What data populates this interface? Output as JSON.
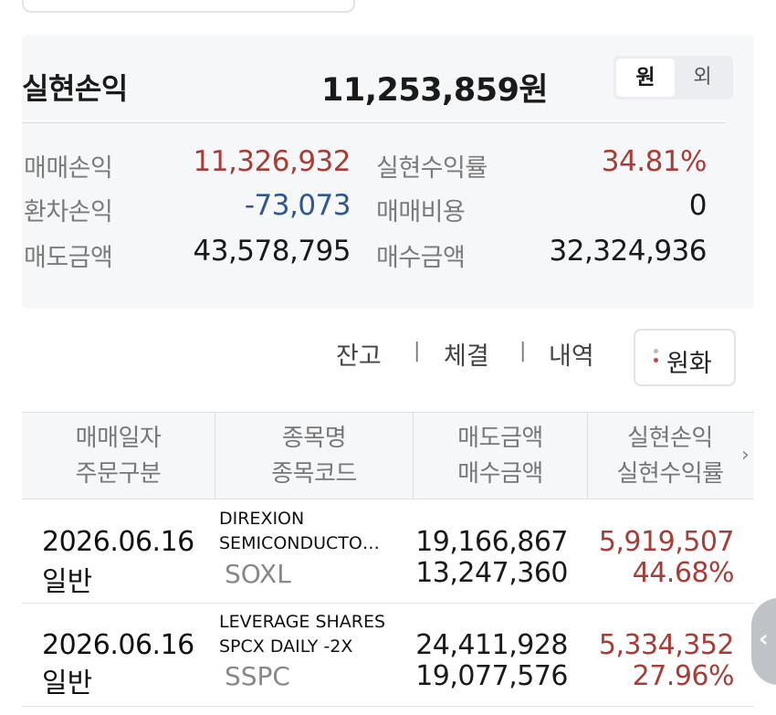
{
  "summary": {
    "title": "실현손익",
    "total": "11,253,859원",
    "currency_toggle": {
      "krw": "원",
      "usd": "외"
    },
    "trade_pl_label": "매매손익",
    "trade_pl_value": "11,326,932",
    "fx_pl_label": "환차손익",
    "fx_pl_value": "-73,073",
    "sell_amount_label": "매도금액",
    "sell_amount_value": "43,578,795",
    "return_rate_label": "실현수익률",
    "return_rate_value": "34.81%",
    "fee_label": "매매비용",
    "fee_value": "0",
    "buy_amount_label": "매수금액",
    "buy_amount_value": "32,324,936"
  },
  "tabs": {
    "balance": "잔고",
    "executions": "체결",
    "history": "내역",
    "separator": "|",
    "krw_button": "원화"
  },
  "table": {
    "headers": {
      "c1_line1": "매매일자",
      "c1_line2": "주문구분",
      "c2_line1": "종목명",
      "c2_line2": "종목코드",
      "c3_line1": "매도금액",
      "c3_line2": "매수금액",
      "c4_line1": "실현손익",
      "c4_line2": "실현수익률",
      "more": "›"
    },
    "rows": [
      {
        "date": "2026.06.16",
        "order_type": "일반",
        "name_line1": "DIREXION",
        "name_line2": "SEMICONDUCTO…",
        "code": "SOXL",
        "sell_amount": "19,166,867",
        "buy_amount": "13,247,360",
        "realized_pl": "5,919,507",
        "return_rate": "44.68%"
      },
      {
        "date": "2026.06.16",
        "order_type": "일반",
        "name_line1": "LEVERAGE SHARES",
        "name_line2": "SPCX DAILY -2X",
        "code": "SSPC",
        "sell_amount": "24,411,928",
        "buy_amount": "19,077,576",
        "realized_pl": "5,334,352",
        "return_rate": "27.96%"
      }
    ]
  },
  "icons": {
    "side_handle": "chevron-left-icon"
  },
  "colors": {
    "profit": "#a63e37",
    "loss": "#2e5695"
  }
}
